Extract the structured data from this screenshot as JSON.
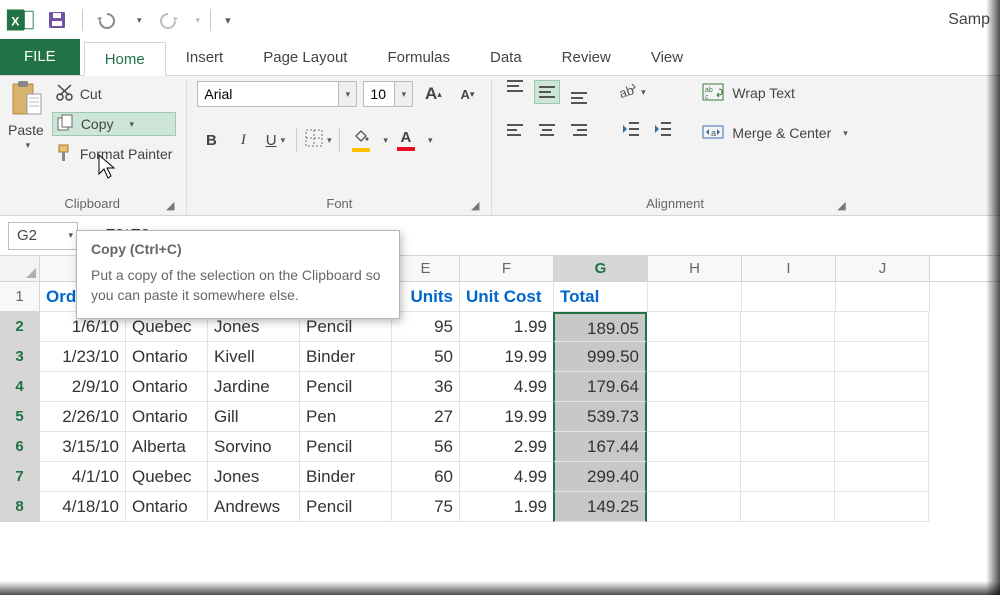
{
  "doc_title": "Samp",
  "tabs": {
    "file": "FILE",
    "home": "Home",
    "insert": "Insert",
    "page_layout": "Page Layout",
    "formulas": "Formulas",
    "data": "Data",
    "review": "Review",
    "view": "View"
  },
  "clipboard": {
    "paste": "Paste",
    "cut": "Cut",
    "copy": "Copy",
    "format_painter": "Format Painter",
    "group": "Clipboard"
  },
  "font": {
    "name": "Arial",
    "size": "10",
    "group": "Font",
    "bold": "B",
    "italic": "I",
    "underline": "U",
    "incA": "A",
    "decA": "A",
    "colorA": "A"
  },
  "alignment": {
    "wrap": "Wrap Text",
    "merge": "Merge & Center",
    "group": "Alignment"
  },
  "namebox": "G2",
  "formula": "=F2*E2",
  "cols": [
    "",
    "",
    "",
    "",
    "E",
    "F",
    "G",
    "H",
    "I",
    "J"
  ],
  "headers": {
    "A": "Ord",
    "E": "Units",
    "F": "Unit Cost",
    "G": "Total"
  },
  "rows": [
    {
      "n": "2",
      "A": "1/6/10",
      "B": "Quebec",
      "C": "Jones",
      "D": "Pencil",
      "E": "95",
      "F": "1.99",
      "G": "189.05"
    },
    {
      "n": "3",
      "A": "1/23/10",
      "B": "Ontario",
      "C": "Kivell",
      "D": "Binder",
      "E": "50",
      "F": "19.99",
      "G": "999.50"
    },
    {
      "n": "4",
      "A": "2/9/10",
      "B": "Ontario",
      "C": "Jardine",
      "D": "Pencil",
      "E": "36",
      "F": "4.99",
      "G": "179.64"
    },
    {
      "n": "5",
      "A": "2/26/10",
      "B": "Ontario",
      "C": "Gill",
      "D": "Pen",
      "E": "27",
      "F": "19.99",
      "G": "539.73"
    },
    {
      "n": "6",
      "A": "3/15/10",
      "B": "Alberta",
      "C": "Sorvino",
      "D": "Pencil",
      "E": "56",
      "F": "2.99",
      "G": "167.44"
    },
    {
      "n": "7",
      "A": "4/1/10",
      "B": "Quebec",
      "C": "Jones",
      "D": "Binder",
      "E": "60",
      "F": "4.99",
      "G": "299.40"
    },
    {
      "n": "8",
      "A": "4/18/10",
      "B": "Ontario",
      "C": "Andrews",
      "D": "Pencil",
      "E": "75",
      "F": "1.99",
      "G": "149.25"
    }
  ],
  "tooltip": {
    "title": "Copy (Ctrl+C)",
    "body": "Put a copy of the selection on the Clipboard so you can paste it somewhere else."
  }
}
